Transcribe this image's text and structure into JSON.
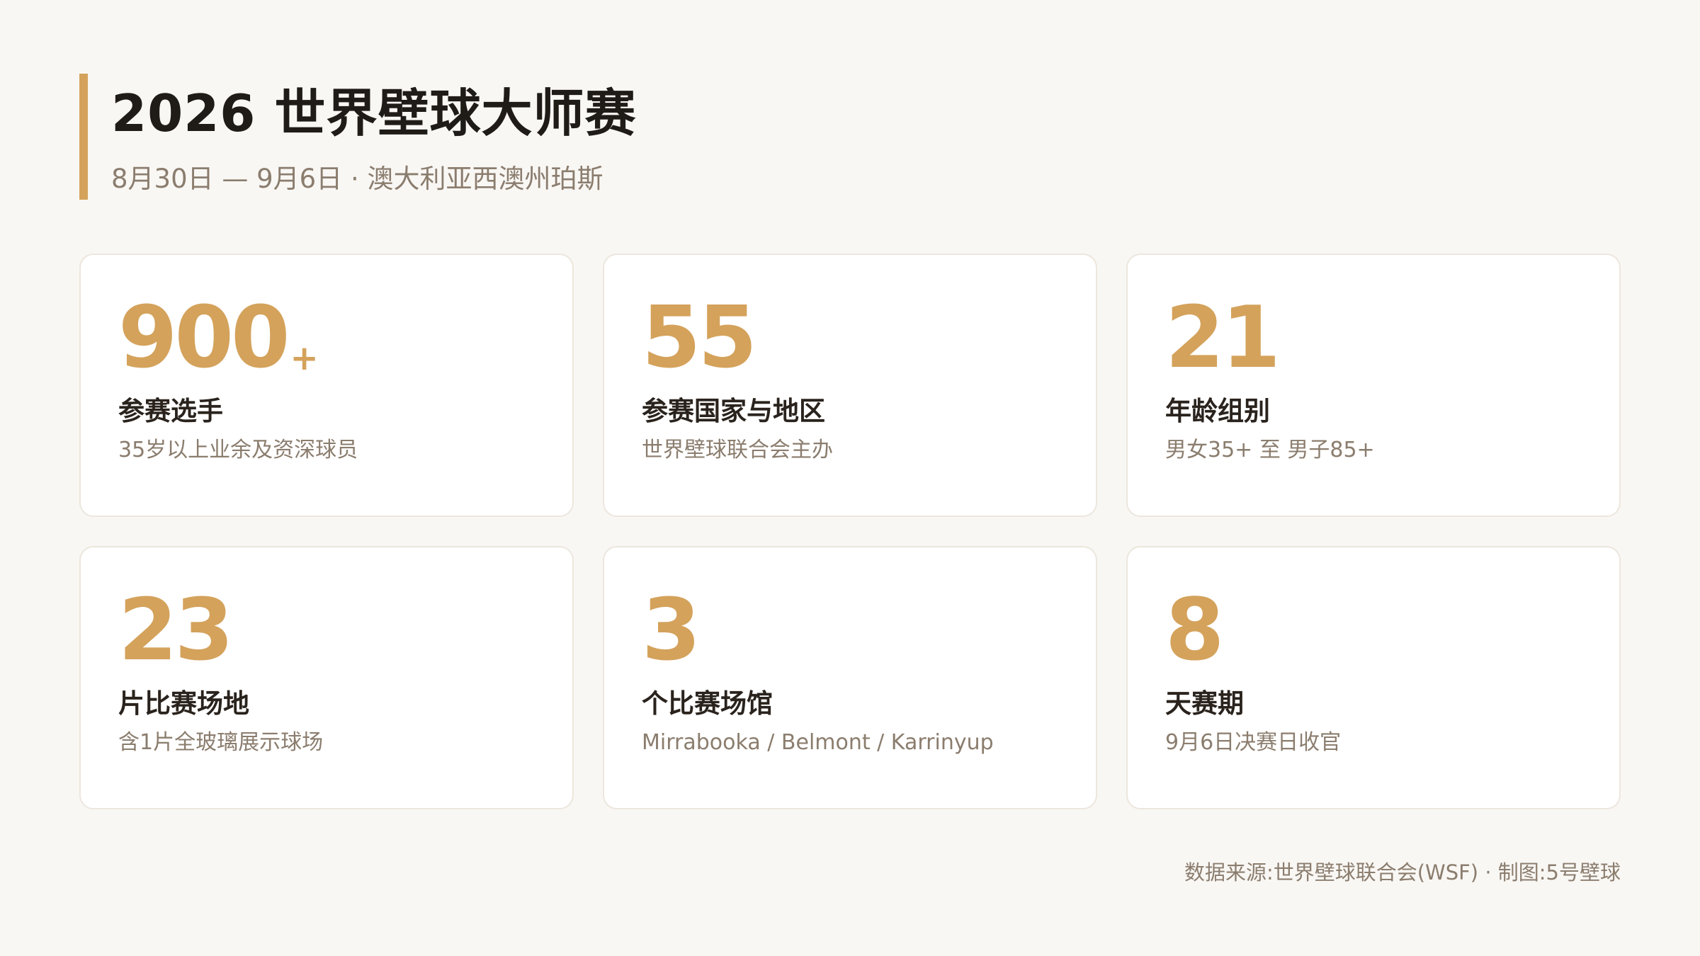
{
  "header": {
    "title": "2026 世界壁球大师赛",
    "subtitle": "8月30日 — 9月6日 · 澳大利亚西澳州珀斯"
  },
  "stats": [
    {
      "value": "900",
      "suffix": "+",
      "label": "参赛选手",
      "desc": "35岁以上业余及资深球员"
    },
    {
      "value": "55",
      "suffix": "",
      "label": "参赛国家与地区",
      "desc": "世界壁球联合会主办"
    },
    {
      "value": "21",
      "suffix": "",
      "label": "年龄组别",
      "desc": "男女35+ 至 男子85+"
    },
    {
      "value": "23",
      "suffix": "",
      "label": "片比赛场地",
      "desc": "含1片全玻璃展示球场"
    },
    {
      "value": "3",
      "suffix": "",
      "label": "个比赛场馆",
      "desc": "Mirrabooka / Belmont / Karrinyup"
    },
    {
      "value": "8",
      "suffix": "",
      "label": "天赛期",
      "desc": "9月6日决赛日收官"
    }
  ],
  "footer": {
    "source": "数据来源:世界壁球联合会(WSF) · 制图:5号壁球"
  },
  "colors": {
    "accent": "#d4a25b",
    "background": "#f9f7f4",
    "card": "#ffffff",
    "muted_text": "#8b7d6e"
  }
}
